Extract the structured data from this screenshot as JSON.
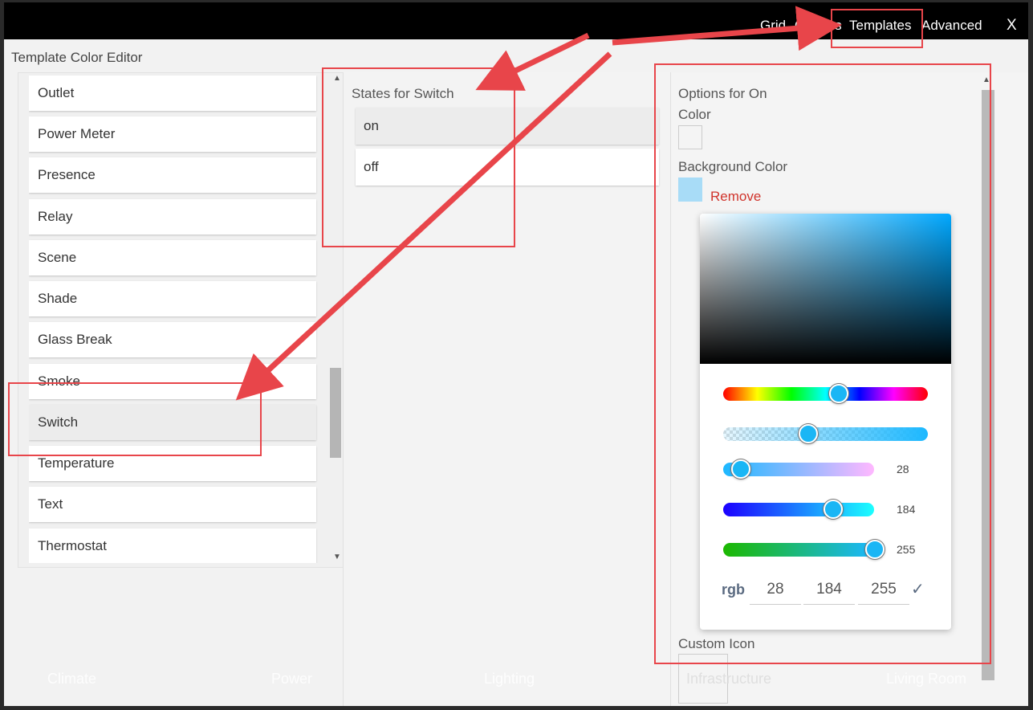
{
  "topbar": {
    "tabs": [
      "Grid",
      "Options",
      "Templates",
      "Advanced"
    ],
    "close_label": "X"
  },
  "editor_title": "Template Color Editor",
  "device_types": [
    "Outlet",
    "Power Meter",
    "Presence",
    "Relay",
    "Scene",
    "Shade",
    "Glass Break",
    "Smoke",
    "Switch",
    "Temperature",
    "Text",
    "Thermostat"
  ],
  "selected_device": "Switch",
  "states": {
    "title": "States for Switch",
    "items": [
      "on",
      "off"
    ],
    "selected": "on"
  },
  "options": {
    "title": "Options for On",
    "color_label": "Color",
    "color_value": "#f4f4f4",
    "bg_color_label": "Background Color",
    "bg_color_value": "#a8dcf7",
    "remove_label": "Remove",
    "custom_icon_label": "Custom Icon"
  },
  "picker": {
    "hue_level": 0.56,
    "alpha_level": 0.41,
    "r": "28",
    "g": "184",
    "b": "255",
    "rgb_label": "rgb"
  },
  "background_tiles": [
    "Climate",
    "Power",
    "Lighting",
    "Infrastructure",
    "Living Room"
  ],
  "colors": {
    "accent_red": "#e8454a",
    "knob": "#1ab6f5"
  }
}
